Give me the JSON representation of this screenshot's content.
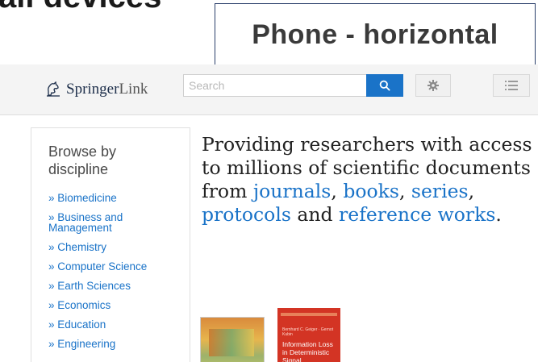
{
  "slide": {
    "heading": "all devices",
    "label": "Phone - horizontal"
  },
  "header": {
    "logo_text": "Springer",
    "logo_text_light": "Link",
    "logo_icon": "springer-horse-icon",
    "search_placeholder": "Search",
    "search_icon": "search-icon",
    "settings_icon": "gear-icon",
    "menu_icon": "list-menu-icon"
  },
  "sidebar": {
    "title": "Browse by discipline",
    "items": [
      "» Biomedicine",
      "» Business and Management",
      "» Chemistry",
      "» Computer Science",
      "» Earth Sciences",
      "» Economics",
      "» Education",
      "» Engineering"
    ]
  },
  "hero": {
    "intro": "Providing researchers with access to millions of scientific documents from ",
    "link_journals": "journals",
    "sep1": ", ",
    "link_books": "books",
    "sep2": ", ",
    "link_series": "series",
    "sep3": ",",
    "link_protocols": "protocols",
    "and_text": " and ",
    "link_reference": "reference works",
    "end": "."
  },
  "covers": {
    "book2_title": "Information Loss in Deterministic Signal Processing",
    "book2_authors": "Bernhard C. Geiger · Gernot Kubin"
  },
  "colors": {
    "accent": "#1a73c8",
    "cover_red": "#d33424",
    "label_border": "#2a3f6a"
  }
}
